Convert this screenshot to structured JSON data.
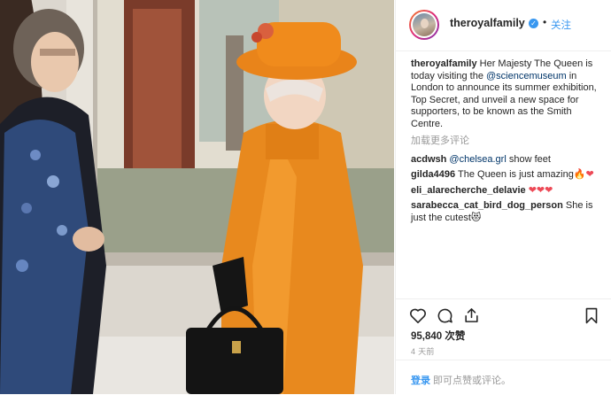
{
  "post": {
    "username": "theroyalfamily",
    "verified_icon": "verified-badge-icon",
    "separator": "•",
    "follow_label": "关注"
  },
  "caption": {
    "username": "theroyalfamily",
    "text_before": " Her Majesty The Queen is today visiting the ",
    "mention": "@sciencemuseum",
    "text_after": " in London to announce its summer exhibition, Top Secret, and unveil a new space for supporters, to be known as the Smith Centre."
  },
  "load_more_label": "加载更多评论",
  "comments": [
    {
      "username": "acdwsh",
      "mention": "@chelsea.grl",
      "text": " show feet"
    },
    {
      "username": "gilda4496",
      "text": " The Queen is just amazing",
      "emoji": "🔥❤"
    },
    {
      "username": "eli_alarecherche_delavie",
      "text": " ",
      "emoji": "❤❤❤"
    },
    {
      "username": "sarabecca_cat_bird_dog_person",
      "text": " She is just the cutest",
      "emoji": "😻"
    }
  ],
  "actions": {
    "like_icon": "heart-icon",
    "comment_icon": "comment-icon",
    "share_icon": "share-icon",
    "save_icon": "bookmark-icon"
  },
  "likes_count": "95,840 次赞",
  "posted_time": "4 天前",
  "footer": {
    "login_label": "登录",
    "hint_text": "即可点赞或评论。"
  },
  "colors": {
    "link_blue": "#3897f0",
    "mention_blue": "#003569",
    "coat_orange": "#e8891e",
    "heart_red": "#ed4956"
  }
}
